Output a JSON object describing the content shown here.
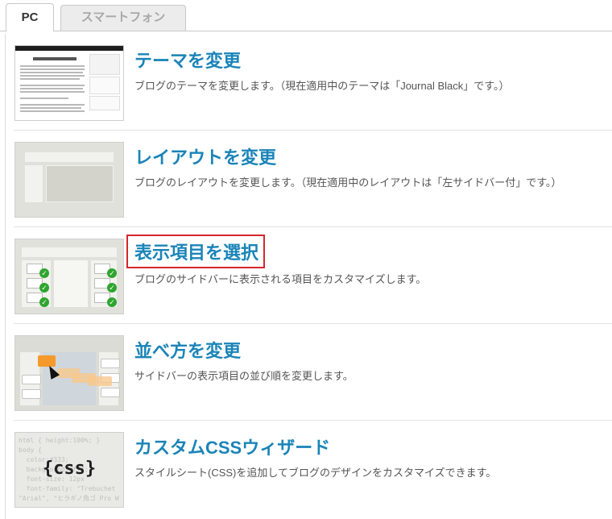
{
  "tabs": [
    {
      "label": "PC",
      "active": true
    },
    {
      "label": "スマートフォン",
      "active": false
    }
  ],
  "items": [
    {
      "title": "テーマを変更",
      "desc": "ブログのテーマを変更します。（現在適用中のテーマは「Journal Black」です。）",
      "thumb_icon": "theme-preview-icon"
    },
    {
      "title": "レイアウトを変更",
      "desc": "ブログのレイアウトを変更します。（現在適用中のレイアウトは「左サイドバー付」です。）",
      "thumb_icon": "layout-icon"
    },
    {
      "title": "表示項目を選択",
      "desc": "ブログのサイドバーに表示される項目をカスタマイズします。",
      "thumb_icon": "display-items-icon"
    },
    {
      "title": "並べ方を変更",
      "desc": "サイドバーの表示項目の並び順を変更します。",
      "thumb_icon": "reorder-icon"
    },
    {
      "title": "カスタムCSSウィザード",
      "desc": "スタイルシート(CSS)を追加してブログのデザインをカスタマイズできます。",
      "thumb_icon": "css-icon",
      "thumb_text": "{css}",
      "thumb_code": "html { height:100%; }\nbody {\n  color:#333;\n  background:#fff;\n  font-size: 12px\n  font-family: \"Trebuchet\n\"Arial\", \"ヒラギノ角ゴ Pro W"
    }
  ],
  "colors": {
    "link": "#1a84b8",
    "highlight_border": "#d6262c",
    "check_green": "#2fa52f",
    "drag_orange": "#f59a2a"
  }
}
